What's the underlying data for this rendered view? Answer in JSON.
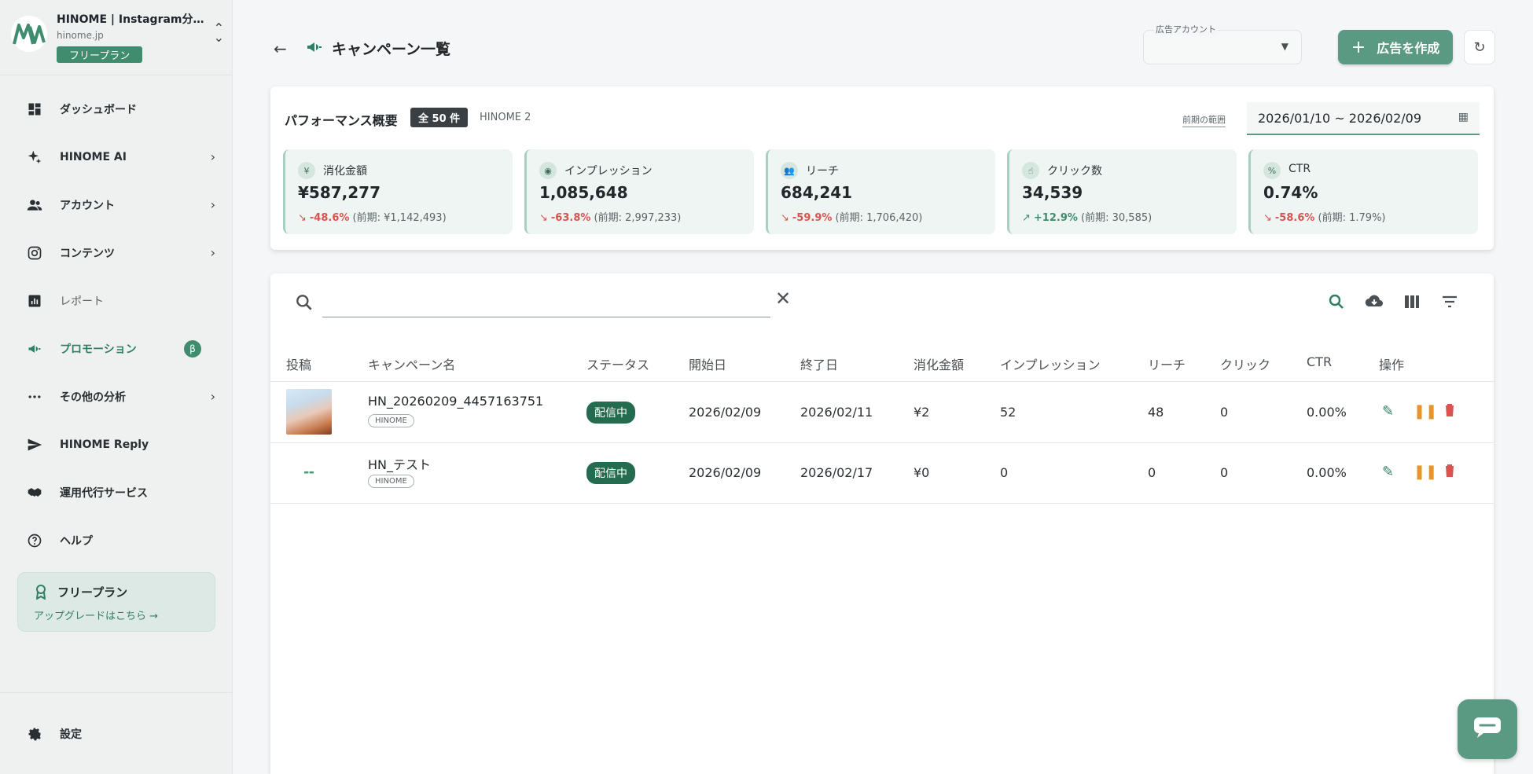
{
  "sidebar": {
    "brand_title": "HINOME | Instagram分析...",
    "brand_domain": "hinome.jp",
    "plan_badge": "フリープラン",
    "items": [
      {
        "label": "ダッシュボード",
        "icon": "dashboard-icon",
        "chevron": false
      },
      {
        "label": "HINOME AI",
        "icon": "sparkle-icon",
        "chevron": true
      },
      {
        "label": "アカウント",
        "icon": "people-icon",
        "chevron": true
      },
      {
        "label": "コンテンツ",
        "icon": "instagram-icon",
        "chevron": true
      },
      {
        "label": "レポート",
        "icon": "report-icon",
        "chevron": false
      },
      {
        "label": "プロモーション",
        "icon": "megaphone-icon",
        "chevron": false,
        "badge": "β",
        "active": true
      },
      {
        "label": "その他の分析",
        "icon": "more-icon",
        "chevron": true
      },
      {
        "label": "HINOME Reply",
        "icon": "send-icon",
        "chevron": false
      },
      {
        "label": "運用代行サービス",
        "icon": "handshake-icon",
        "chevron": false
      },
      {
        "label": "ヘルプ",
        "icon": "help-icon",
        "chevron": false
      }
    ],
    "upgrade": {
      "title": "フリープラン",
      "link": "アップグレードはこちら →"
    },
    "settings_label": "設定"
  },
  "header": {
    "title": "キャンペーン一覧",
    "account_select_label": "広告アカウント",
    "account_select_value": "",
    "create_button": "広告を作成"
  },
  "performance": {
    "title": "パフォーマンス概要",
    "count_badge": "全 50 件",
    "account_name": "HINOME 2",
    "period_label": "前期の範囲",
    "date_range": "2026/01/10 ~ 2026/02/09",
    "metrics": [
      {
        "label": "消化金額",
        "value": "¥587,277",
        "change": "-48.6%",
        "direction": "down",
        "previous": "(前期: ¥1,142,493)"
      },
      {
        "label": "インプレッション",
        "value": "1,085,648",
        "change": "-63.8%",
        "direction": "down",
        "previous": "(前期: 2,997,233)"
      },
      {
        "label": "リーチ",
        "value": "684,241",
        "change": "-59.9%",
        "direction": "down",
        "previous": "(前期: 1,706,420)"
      },
      {
        "label": "クリック数",
        "value": "34,539",
        "change": "+12.9%",
        "direction": "up",
        "previous": "(前期: 30,585)"
      },
      {
        "label": "CTR",
        "value": "0.74%",
        "change": "-58.6%",
        "direction": "down",
        "previous": "(前期: 1.79%)"
      }
    ]
  },
  "table": {
    "search_placeholder": "",
    "columns": [
      "投稿",
      "キャンペーン名",
      "ステータス",
      "開始日",
      "終了日",
      "消化金額",
      "インプレッション",
      "リーチ",
      "クリック",
      "CTR",
      "操作"
    ],
    "rows": [
      {
        "name": "HN_20260209_4457163751",
        "tag": "HINOME",
        "status": "配信中",
        "start": "2026/02/09",
        "end": "2026/02/11",
        "spend": "¥2",
        "impressions": "52",
        "reach": "48",
        "clicks": "0",
        "ctr": "0.00%"
      },
      {
        "name": "HN_テスト",
        "tag": "HINOME",
        "status": "配信中",
        "start": "2026/02/09",
        "end": "2026/02/17",
        "spend": "¥0",
        "impressions": "0",
        "reach": "0",
        "clicks": "0",
        "ctr": "0.00%"
      }
    ]
  },
  "colors": {
    "accent": "#3f8c6e",
    "danger": "#d9534f",
    "warning": "#e8942c"
  }
}
